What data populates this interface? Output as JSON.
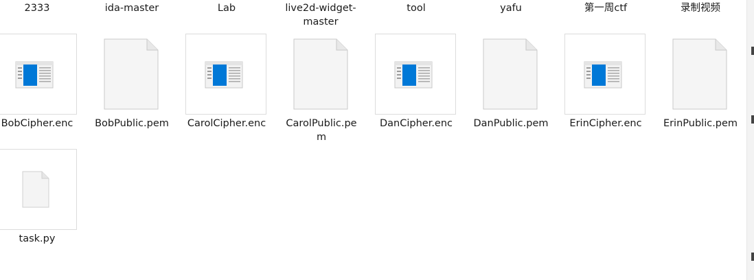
{
  "folders_row": [
    {
      "name": "2333"
    },
    {
      "name": "ida-master"
    },
    {
      "name": "Lab"
    },
    {
      "name": "live2d-widget-\nmaster"
    },
    {
      "name": "tool"
    },
    {
      "name": "yafu"
    },
    {
      "name": "第一周ctf"
    },
    {
      "name": "录制视频"
    }
  ],
  "files": [
    {
      "name": "BobCipher.enc",
      "icon": "app-window-icon"
    },
    {
      "name": "BobPublic.pem",
      "icon": "blank-document-icon"
    },
    {
      "name": "CarolCipher.enc",
      "icon": "app-window-icon"
    },
    {
      "name": "CarolPublic.pe\nm",
      "icon": "blank-document-icon"
    },
    {
      "name": "DanCipher.enc",
      "icon": "app-window-icon"
    },
    {
      "name": "DanPublic.pem",
      "icon": "blank-document-icon"
    },
    {
      "name": "ErinCipher.enc",
      "icon": "app-window-icon"
    },
    {
      "name": "ErinPublic.pem",
      "icon": "blank-document-icon"
    },
    {
      "name": "task.py",
      "icon": "python-file-icon"
    }
  ],
  "colors": {
    "accent_blue": "#0078d7",
    "text": "#1a1a1a",
    "tile_border": "#dcdcdc"
  }
}
